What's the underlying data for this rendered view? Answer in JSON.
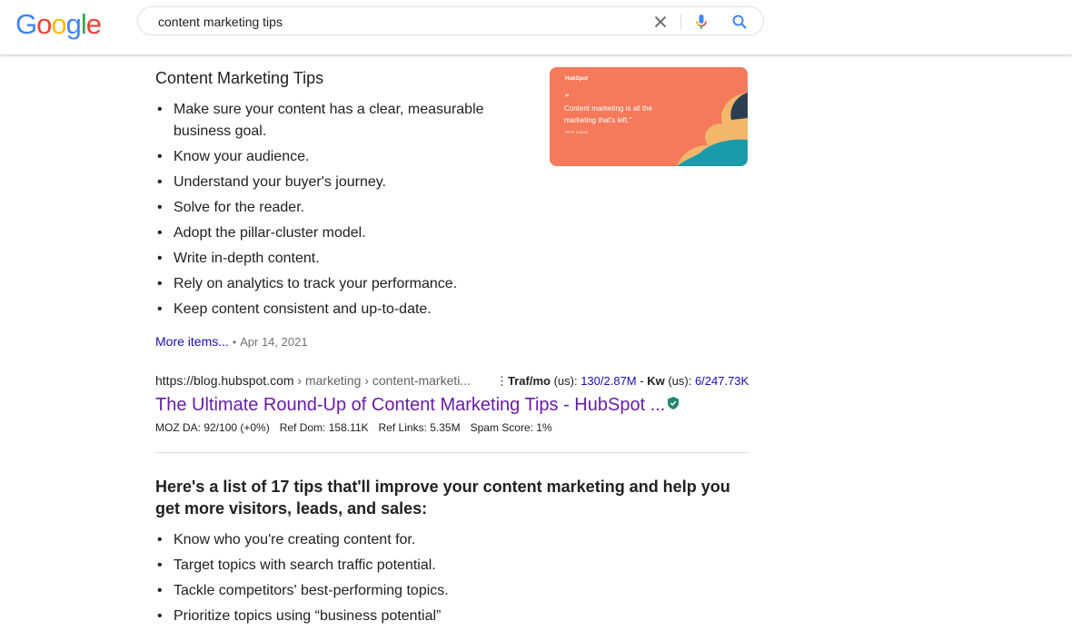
{
  "search": {
    "query": "content marketing tips"
  },
  "logo": {
    "letters": [
      "G",
      "o",
      "o",
      "g",
      "l",
      "e"
    ]
  },
  "snippet": {
    "title": "Content Marketing Tips",
    "tips": [
      "Make sure your content has a clear, measurable business goal.",
      "Know your audience.",
      "Understand your buyer's journey.",
      "Solve for the reader.",
      "Adopt the pillar-cluster model.",
      "Write in-depth content.",
      "Rely on analytics to track your performance.",
      "Keep content consistent and up-to-date."
    ],
    "more_label": "More items...",
    "date": "Apr 14, 2021",
    "thumbnail": {
      "brand": "HubSpot",
      "quote": "Content marketing is all the marketing that's left.\"",
      "author": "SETH GODIN"
    }
  },
  "result": {
    "url_base": "https://blog.hubspot.com",
    "url_crumbs": " › marketing › content-marketi...",
    "traf_label": "Traf/mo",
    "traf_region": " (us): ",
    "traf_value": "130/2.87M",
    "kw_sep": " - ",
    "kw_label": "Kw",
    "kw_region": " (us): ",
    "kw_value": "6/247.73K",
    "title": "The Ultimate Round-Up of Content Marketing Tips - HubSpot ...",
    "moz_da": "MOZ DA: 92/100 (+0%)",
    "ref_dom": "Ref Dom: 158.11K",
    "ref_links": "Ref Links: 5.35M",
    "spam_score": "Spam Score: 1%"
  },
  "snippet2": {
    "title": "Here's a list of 17 tips that'll improve your content marketing and help you get more visitors, leads, and sales:",
    "tips": [
      "Know who you're creating content for.",
      "Target topics with search traffic potential.",
      "Tackle competitors' best-performing topics.",
      "Prioritize topics using “business potential”"
    ]
  },
  "colors": {
    "link": "#1a0dab",
    "visited": "#681da8",
    "thumb_bg": "#f47a5b",
    "verified": "#20876e"
  }
}
